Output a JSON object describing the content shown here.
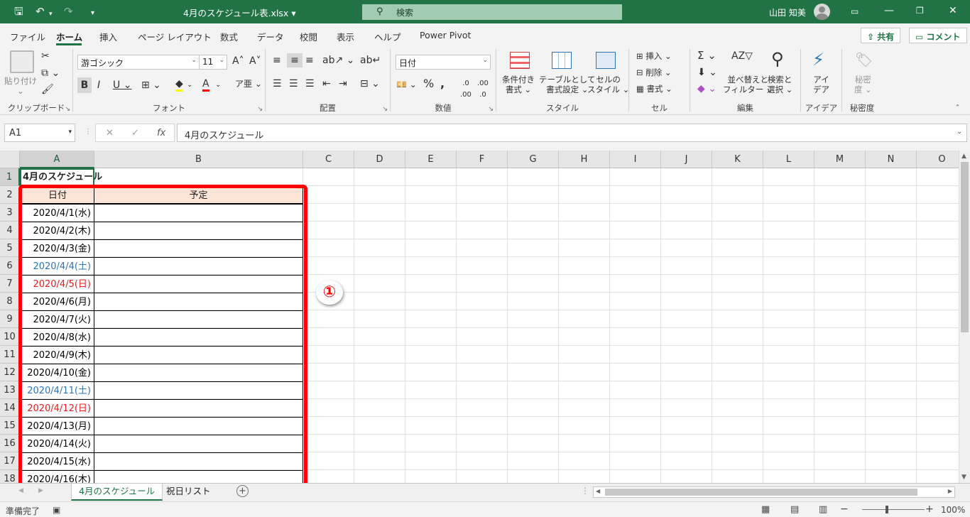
{
  "window": {
    "filename": "4月のスケジュール表.xlsx",
    "search_placeholder": "検索",
    "user_name": "山田 知美"
  },
  "menu": {
    "tabs": [
      "ファイル",
      "ホーム",
      "挿入",
      "ページ レイアウト",
      "数式",
      "データ",
      "校閲",
      "表示",
      "ヘルプ",
      "Power Pivot"
    ],
    "active_tab": "ホーム",
    "share_label": "共有",
    "comment_label": "コメント"
  },
  "ribbon": {
    "clipboard": {
      "paste": "貼り付け",
      "group": "クリップボード"
    },
    "font": {
      "name": "游ゴシック",
      "size": "11",
      "group": "フォント"
    },
    "alignment": {
      "group": "配置"
    },
    "number": {
      "format": "日付",
      "group": "数値"
    },
    "styles": {
      "conditional_1": "条件付き",
      "conditional_2": "書式",
      "table_1": "テーブルとして",
      "table_2": "書式設定",
      "cell_1": "セルの",
      "cell_2": "スタイル",
      "group": "スタイル"
    },
    "cells": {
      "insert": "挿入",
      "delete": "削除",
      "format": "書式",
      "group": "セル"
    },
    "editing": {
      "sort_1": "並べ替えと",
      "sort_2": "フィルター",
      "find_1": "検索と",
      "find_2": "選択",
      "group": "編集"
    },
    "ideas": {
      "label_1": "アイ",
      "label_2": "デア",
      "group": "アイデア"
    },
    "sensitivity": {
      "label_1": "秘密",
      "label_2": "度",
      "group": "秘密度"
    }
  },
  "formula_bar": {
    "name_box": "A1",
    "fx": "fx",
    "content": "4月のスケジュール"
  },
  "columns": [
    "A",
    "B",
    "C",
    "D",
    "E",
    "F",
    "G",
    "H",
    "I",
    "J",
    "K",
    "L",
    "M",
    "N",
    "O"
  ],
  "rows": [
    "1",
    "2",
    "3",
    "4",
    "5",
    "6",
    "7",
    "8",
    "9",
    "10",
    "11",
    "12",
    "13",
    "14",
    "15",
    "16",
    "17",
    "18"
  ],
  "sheet": {
    "title": "4月のスケジュール",
    "header_date": "日付",
    "header_plan": "予定",
    "dates": [
      {
        "text": "2020/4/1(水)",
        "kind": "weekday"
      },
      {
        "text": "2020/4/2(木)",
        "kind": "weekday"
      },
      {
        "text": "2020/4/3(金)",
        "kind": "weekday"
      },
      {
        "text": "2020/4/4(土)",
        "kind": "saturday"
      },
      {
        "text": "2020/4/5(日)",
        "kind": "sunday"
      },
      {
        "text": "2020/4/6(月)",
        "kind": "weekday"
      },
      {
        "text": "2020/4/7(火)",
        "kind": "weekday"
      },
      {
        "text": "2020/4/8(水)",
        "kind": "weekday"
      },
      {
        "text": "2020/4/9(木)",
        "kind": "weekday"
      },
      {
        "text": "2020/4/10(金)",
        "kind": "weekday"
      },
      {
        "text": "2020/4/11(土)",
        "kind": "saturday"
      },
      {
        "text": "2020/4/12(日)",
        "kind": "sunday"
      },
      {
        "text": "2020/4/13(月)",
        "kind": "weekday"
      },
      {
        "text": "2020/4/14(火)",
        "kind": "weekday"
      },
      {
        "text": "2020/4/15(水)",
        "kind": "weekday"
      },
      {
        "text": "2020/4/16(木)",
        "kind": "weekday"
      }
    ],
    "colors": {
      "weekday": "#000000",
      "saturday": "#2e75b6",
      "sunday": "#e02020",
      "header_fill": "#fce4d6",
      "highlight": "#ff0000",
      "accent": "#217346"
    }
  },
  "annotation": {
    "marker": "①"
  },
  "sheet_tabs": [
    "4月のスケジュール",
    "祝日リスト"
  ],
  "status": {
    "ready": "準備完了",
    "zoom": "100%"
  }
}
